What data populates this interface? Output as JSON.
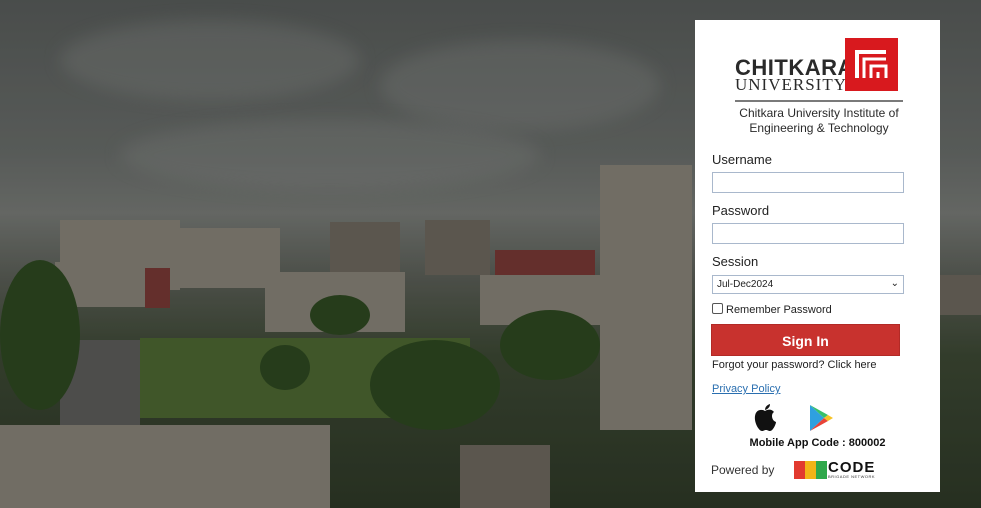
{
  "brand": {
    "name_line1": "CHITKARA",
    "name_line2": "UNIVERSITY",
    "institute": "Chitkara University Institute of Engineering & Technology",
    "accent": "#d8191e"
  },
  "form": {
    "username_label": "Username",
    "username_value": "",
    "password_label": "Password",
    "password_value": "",
    "session_label": "Session",
    "session_value": "Jul-Dec2024",
    "remember_label": "Remember Password",
    "remember_checked": false,
    "signin_label": "Sign In",
    "forgot_label": "Forgot your password? Click here",
    "privacy_label": "Privacy Policy"
  },
  "apps": {
    "ios_icon": "apple-icon",
    "android_icon": "google-play-icon",
    "code_label": "Mobile App Code : 800002"
  },
  "footer": {
    "powered_label": "Powered by",
    "vendor_word": "CODE",
    "vendor_sub": "BRIGADE NETWORK"
  },
  "colors": {
    "signin_bg": "#c8322e",
    "link": "#2a6fb0"
  }
}
